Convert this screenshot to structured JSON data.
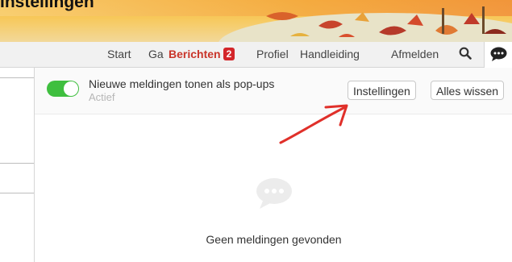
{
  "heading": "Instellingen",
  "nav": {
    "items": [
      "Start",
      "Ga",
      "Berichten",
      "Profiel",
      "Handleiding",
      "Afmelden"
    ],
    "active_item": "Berichten",
    "badge_count": "2",
    "search_icon": "search-icon",
    "chat_icon": "chat-bubble-icon"
  },
  "notifications": {
    "toggle_label": "Nieuwe meldingen tonen als pop-ups",
    "toggle_status": "Actief",
    "toggle_on": true,
    "settings_button": "Instellingen",
    "clear_button": "Alles wissen",
    "empty_message": "Geen meldingen gevonden"
  },
  "colors": {
    "accent_red": "#c9352a",
    "toggle_green": "#3fbf3f",
    "annotation_arrow": "#e0302a"
  }
}
